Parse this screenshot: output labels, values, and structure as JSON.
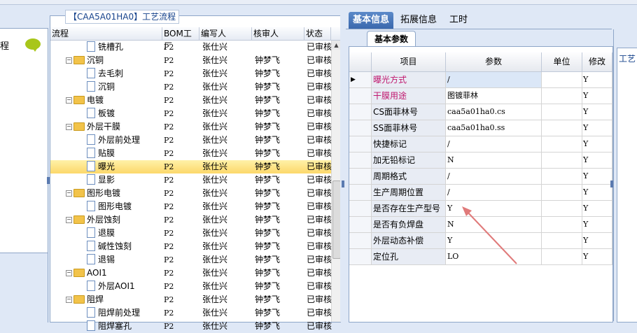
{
  "left_panel": {
    "label": "程"
  },
  "tree_panel": {
    "title": "【CAA5A01HA0】工艺流程",
    "columns": [
      "流程",
      "BOM工厂",
      "编写人",
      "核审人",
      "状态"
    ],
    "rows": [
      {
        "name": "铣槽孔",
        "type": "leaf",
        "level": 2,
        "bom": "P2",
        "writer": "张仕兴",
        "reviewer": "",
        "status": "已审核"
      },
      {
        "name": "沉铜",
        "type": "folder",
        "level": 1,
        "bom": "P2",
        "writer": "张仕兴",
        "reviewer": "钟梦飞",
        "status": "已审核"
      },
      {
        "name": "去毛刺",
        "type": "leaf",
        "level": 2,
        "bom": "P2",
        "writer": "张仕兴",
        "reviewer": "钟梦飞",
        "status": "已审核"
      },
      {
        "name": "沉铜",
        "type": "leaf",
        "level": 2,
        "bom": "P2",
        "writer": "张仕兴",
        "reviewer": "钟梦飞",
        "status": "已审核"
      },
      {
        "name": "电镀",
        "type": "folder",
        "level": 1,
        "bom": "P2",
        "writer": "张仕兴",
        "reviewer": "钟梦飞",
        "status": "已审核"
      },
      {
        "name": "板镀",
        "type": "leaf",
        "level": 2,
        "bom": "P2",
        "writer": "张仕兴",
        "reviewer": "钟梦飞",
        "status": "已审核"
      },
      {
        "name": "外层干膜",
        "type": "folder",
        "level": 1,
        "bom": "P2",
        "writer": "张仕兴",
        "reviewer": "钟梦飞",
        "status": "已审核"
      },
      {
        "name": "外层前处理",
        "type": "leaf",
        "level": 2,
        "bom": "P2",
        "writer": "张仕兴",
        "reviewer": "钟梦飞",
        "status": "已审核"
      },
      {
        "name": "贴膜",
        "type": "leaf",
        "level": 2,
        "bom": "P2",
        "writer": "张仕兴",
        "reviewer": "钟梦飞",
        "status": "已审核"
      },
      {
        "name": "曝光",
        "type": "leaf",
        "level": 2,
        "bom": "P2",
        "writer": "张仕兴",
        "reviewer": "钟梦飞",
        "status": "已审核",
        "selected": true
      },
      {
        "name": "显影",
        "type": "leaf",
        "level": 2,
        "bom": "P2",
        "writer": "张仕兴",
        "reviewer": "钟梦飞",
        "status": "已审核"
      },
      {
        "name": "图形电镀",
        "type": "folder",
        "level": 1,
        "bom": "P2",
        "writer": "张仕兴",
        "reviewer": "钟梦飞",
        "status": "已审核"
      },
      {
        "name": "图形电镀",
        "type": "leaf",
        "level": 2,
        "bom": "P2",
        "writer": "张仕兴",
        "reviewer": "钟梦飞",
        "status": "已审核"
      },
      {
        "name": "外层蚀刻",
        "type": "folder",
        "level": 1,
        "bom": "P2",
        "writer": "张仕兴",
        "reviewer": "钟梦飞",
        "status": "已审核"
      },
      {
        "name": "退膜",
        "type": "leaf",
        "level": 2,
        "bom": "P2",
        "writer": "张仕兴",
        "reviewer": "钟梦飞",
        "status": "已审核"
      },
      {
        "name": "碱性蚀刻",
        "type": "leaf",
        "level": 2,
        "bom": "P2",
        "writer": "张仕兴",
        "reviewer": "钟梦飞",
        "status": "已审核"
      },
      {
        "name": "退锡",
        "type": "leaf",
        "level": 2,
        "bom": "P2",
        "writer": "张仕兴",
        "reviewer": "钟梦飞",
        "status": "已审核"
      },
      {
        "name": "AOI1",
        "type": "folder",
        "level": 1,
        "bom": "P2",
        "writer": "张仕兴",
        "reviewer": "钟梦飞",
        "status": "已审核"
      },
      {
        "name": "外层AOI1",
        "type": "leaf",
        "level": 2,
        "bom": "P2",
        "writer": "张仕兴",
        "reviewer": "钟梦飞",
        "status": "已审核"
      },
      {
        "name": "阻焊",
        "type": "folder",
        "level": 1,
        "bom": "P2",
        "writer": "张仕兴",
        "reviewer": "钟梦飞",
        "status": "已审核"
      },
      {
        "name": "阻焊前处理",
        "type": "leaf",
        "level": 2,
        "bom": "P2",
        "writer": "张仕兴",
        "reviewer": "钟梦飞",
        "status": "已审核"
      },
      {
        "name": "阻焊塞孔",
        "type": "leaf",
        "level": 2,
        "bom": "P2",
        "writer": "张仕兴",
        "reviewer": "钟梦飞",
        "status": "已审核"
      }
    ]
  },
  "tabs": [
    "基本信息",
    "拓展信息",
    "工时"
  ],
  "sub_tab": "基本参数",
  "grid": {
    "columns": [
      "项目",
      "参数",
      "单位",
      "修改"
    ],
    "rows": [
      {
        "item": "曝光方式",
        "param": "/",
        "unit": "",
        "mod": "Y",
        "highlight": true
      },
      {
        "item": "干膜用途",
        "param": "图镀菲林",
        "unit": "",
        "mod": "Y",
        "highlight": true
      },
      {
        "item": "CS面菲林号",
        "param": "caa5a01ha0.cs",
        "unit": "",
        "mod": "Y"
      },
      {
        "item": "SS面菲林号",
        "param": "caa5a01ha0.ss",
        "unit": "",
        "mod": "Y"
      },
      {
        "item": "快捷标记",
        "param": "/",
        "unit": "",
        "mod": "Y"
      },
      {
        "item": "加无铅标记",
        "param": "N",
        "unit": "",
        "mod": "Y"
      },
      {
        "item": "周期格式",
        "param": "/",
        "unit": "",
        "mod": "Y"
      },
      {
        "item": "生产周期位置",
        "param": "/",
        "unit": "",
        "mod": "Y"
      },
      {
        "item": "是否存在生产型号",
        "param": "Y",
        "unit": "",
        "mod": "Y"
      },
      {
        "item": "是否有负焊盘",
        "param": "N",
        "unit": "",
        "mod": "Y"
      },
      {
        "item": "外层动态补偿",
        "param": "Y",
        "unit": "",
        "mod": "Y"
      },
      {
        "item": "定位孔",
        "param": "LO",
        "unit": "",
        "mod": "Y"
      }
    ]
  },
  "far_right": {
    "label": "工艺"
  },
  "colors": {
    "accent": "#3a68ad",
    "selected_row": "#fcd86a",
    "highlight_text": "#c0186e",
    "annotation_arrow": "#e07a7a"
  }
}
